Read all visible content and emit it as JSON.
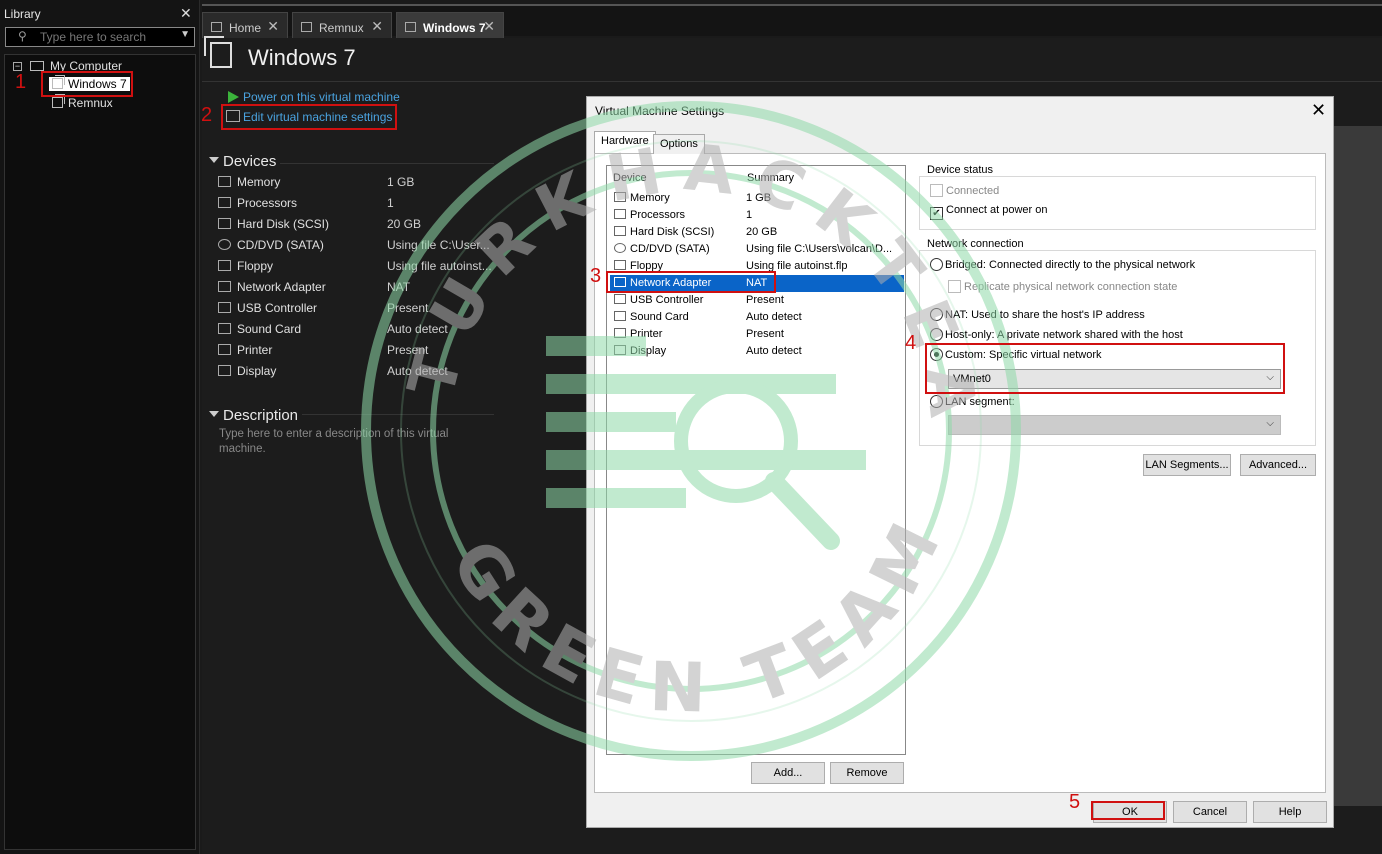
{
  "library": {
    "title": "Library",
    "close": "✕",
    "search_placeholder": "Type here to search",
    "tree": {
      "root": "My Computer",
      "items": [
        "Windows 7",
        "Remnux"
      ]
    }
  },
  "tabs": [
    {
      "label": "Home"
    },
    {
      "label": "Remnux"
    },
    {
      "label": "Windows 7",
      "active": true
    }
  ],
  "tab_close": "✕",
  "vm": {
    "title": "Windows 7",
    "actions": {
      "power_on": "Power on this virtual machine",
      "edit_settings": "Edit virtual machine settings"
    },
    "devices_header": "Devices",
    "devices": [
      {
        "name": "Memory",
        "value": "1 GB"
      },
      {
        "name": "Processors",
        "value": "1"
      },
      {
        "name": "Hard Disk (SCSI)",
        "value": "20 GB"
      },
      {
        "name": "CD/DVD (SATA)",
        "value": "Using file C:\\User..."
      },
      {
        "name": "Floppy",
        "value": "Using file autoinst..."
      },
      {
        "name": "Network Adapter",
        "value": "NAT"
      },
      {
        "name": "USB Controller",
        "value": "Present"
      },
      {
        "name": "Sound Card",
        "value": "Auto detect"
      },
      {
        "name": "Printer",
        "value": "Present"
      },
      {
        "name": "Display",
        "value": "Auto detect"
      }
    ],
    "description_header": "Description",
    "description_placeholder": "Type here to enter a description of this virtual machine."
  },
  "dialog": {
    "title": "Virtual Machine Settings",
    "close": "✕",
    "tabs": [
      "Hardware",
      "Options"
    ],
    "list_headers": {
      "device": "Device",
      "summary": "Summary"
    },
    "devices": [
      {
        "name": "Memory",
        "summary": "1 GB"
      },
      {
        "name": "Processors",
        "summary": "1"
      },
      {
        "name": "Hard Disk (SCSI)",
        "summary": "20 GB"
      },
      {
        "name": "CD/DVD (SATA)",
        "summary": "Using file C:\\Users\\volcan\\D..."
      },
      {
        "name": "Floppy",
        "summary": "Using file autoinst.flp"
      },
      {
        "name": "Network Adapter",
        "summary": "NAT",
        "selected": true
      },
      {
        "name": "USB Controller",
        "summary": "Present"
      },
      {
        "name": "Sound Card",
        "summary": "Auto detect"
      },
      {
        "name": "Printer",
        "summary": "Present"
      },
      {
        "name": "Display",
        "summary": "Auto detect"
      }
    ],
    "add_button": "Add...",
    "remove_button": "Remove",
    "device_status": {
      "label": "Device status",
      "connected": {
        "label": "Connected",
        "checked": false,
        "disabled": true
      },
      "connect_at_power_on": {
        "label": "Connect at power on",
        "checked": true
      }
    },
    "network_connection": {
      "label": "Network connection",
      "bridged": "Bridged: Connected directly to the physical network",
      "replicate": "Replicate physical network connection state",
      "nat": "NAT: Used to share the host's IP address",
      "host_only": "Host-only: A private network shared with the host",
      "custom": "Custom: Specific virtual network",
      "custom_value": "VMnet0",
      "lan_segment": "LAN segment:",
      "selected": "custom"
    },
    "lan_segments_button": "LAN Segments...",
    "advanced_button": "Advanced...",
    "ok_button": "OK",
    "cancel_button": "Cancel",
    "help_button": "Help"
  },
  "annotations": [
    "1",
    "2",
    "3",
    "4",
    "5"
  ],
  "colors": {
    "annotation": "#d01010",
    "link": "#4aa3e0",
    "selection": "#0a64c8",
    "watermark": "#8fd9a8"
  }
}
